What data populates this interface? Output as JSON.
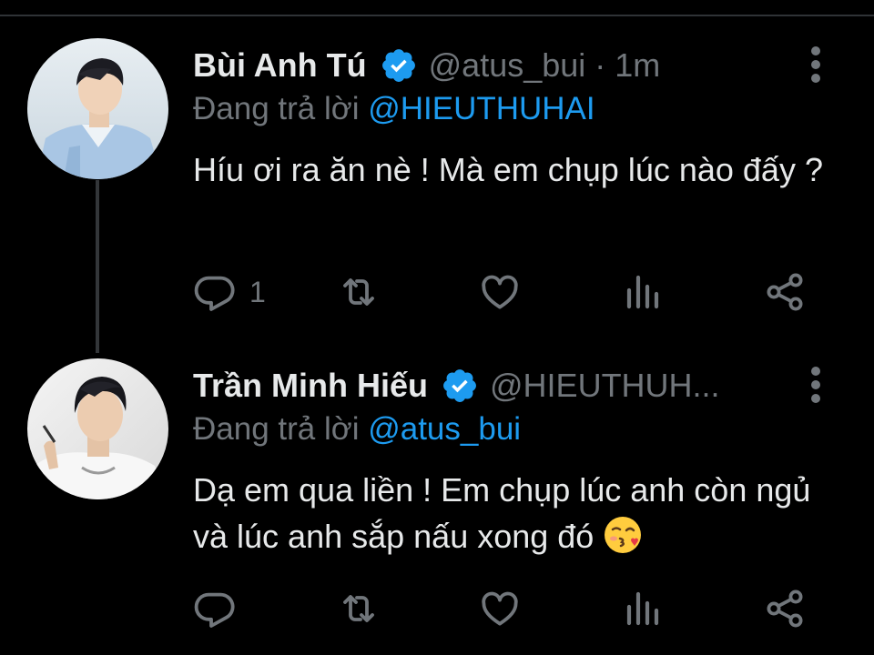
{
  "colors": {
    "background": "#000000",
    "text": "#e7e9ea",
    "muted": "#71767b",
    "link": "#1d9bf0",
    "verified": "#1d9bf0",
    "divider": "#2f3336"
  },
  "tweets": [
    {
      "author_name": "Bùi Anh Tú",
      "handle_time": "@atus_bui · 1m",
      "replying_prefix": "Đang trả lời ",
      "replying_to": "@HIEUTHUHAI",
      "text": "Híu ơi ra ăn nè ! Mà em chụp lúc nào đấy ?",
      "reply_count": "1",
      "icons": [
        "reply-icon",
        "retweet-icon",
        "like-icon",
        "views-icon",
        "share-icon",
        "more-options-icon",
        "verified-badge-icon"
      ]
    },
    {
      "author_name": "Trần Minh Hiếu",
      "handle_time": "@HIEUTHUH...",
      "replying_prefix": "Đang trả lời ",
      "replying_to": "@atus_bui",
      "text": "Dạ em qua liền ! Em chụp lúc anh còn ngủ và lúc anh sắp nấu xong đó ",
      "emoji": "face-blowing-a-kiss",
      "reply_count": "",
      "icons": [
        "reply-icon",
        "retweet-icon",
        "like-icon",
        "views-icon",
        "share-icon",
        "more-options-icon",
        "verified-badge-icon"
      ]
    }
  ]
}
